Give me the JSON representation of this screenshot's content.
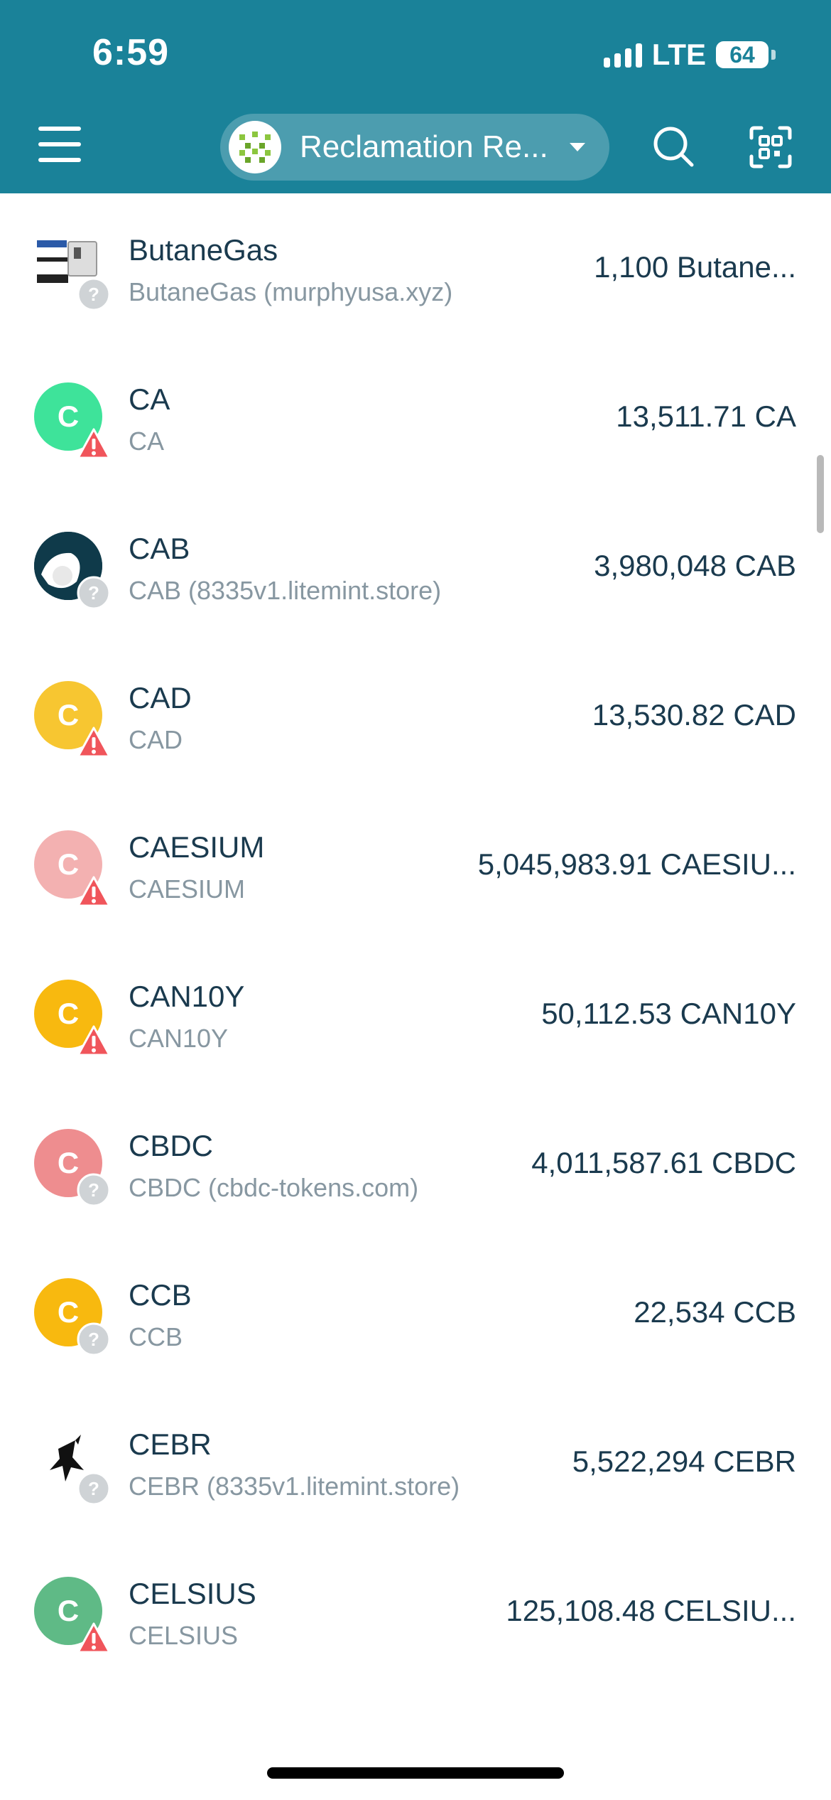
{
  "status": {
    "time": "6:59",
    "network": "LTE",
    "battery": "64",
    "battery_level": 0.64
  },
  "header": {
    "wallet_name": "Reclamation Re...",
    "icons": {
      "menu": "menu-icon",
      "search": "search-icon",
      "scan": "scan-icon",
      "wallet": "wallet-avatar-icon"
    }
  },
  "tokens": [
    {
      "name": "ButaneGas",
      "sub": "ButaneGas (murphyusa.xyz)",
      "balance": "1,100 Butane...",
      "icon_type": "image",
      "icon_color": "#ffffff",
      "badge": "question"
    },
    {
      "name": "CA",
      "sub": "CA",
      "balance": "13,511.71 CA",
      "icon_type": "letter",
      "letter": "C",
      "icon_color": "#3ee39a",
      "badge": "warning"
    },
    {
      "name": "CAB",
      "sub": "CAB (8335v1.litemint.store)",
      "balance": "3,980,048 CAB",
      "icon_type": "image",
      "icon_color": "#0f3a4a",
      "badge": "question"
    },
    {
      "name": "CAD",
      "sub": "CAD",
      "balance": "13,530.82 CAD",
      "icon_type": "letter",
      "letter": "C",
      "icon_color": "#f7c631",
      "badge": "warning"
    },
    {
      "name": "CAESIUM",
      "sub": "CAESIUM",
      "balance": "5,045,983.91 CAESIU...",
      "icon_type": "letter",
      "letter": "C",
      "icon_color": "#f3b1b1",
      "badge": "warning"
    },
    {
      "name": "CAN10Y",
      "sub": "CAN10Y",
      "balance": "50,112.53 CAN10Y",
      "icon_type": "letter",
      "letter": "C",
      "icon_color": "#f8b90f",
      "badge": "warning"
    },
    {
      "name": "CBDC",
      "sub": "CBDC (cbdc-tokens.com)",
      "balance": "4,011,587.61 CBDC",
      "icon_type": "letter",
      "letter": "C",
      "icon_color": "#ee8d8f",
      "badge": "question"
    },
    {
      "name": "CCB",
      "sub": "CCB",
      "balance": "22,534 CCB",
      "icon_type": "letter",
      "letter": "C",
      "icon_color": "#f8b90f",
      "badge": "question"
    },
    {
      "name": "CEBR",
      "sub": "CEBR (8335v1.litemint.store)",
      "balance": "5,522,294 CEBR",
      "icon_type": "image",
      "icon_color": "#ffffff",
      "badge": "question"
    },
    {
      "name": "CELSIUS",
      "sub": "CELSIUS",
      "balance": "125,108.48 CELSIU...",
      "icon_type": "letter",
      "letter": "C",
      "icon_color": "#5fba86",
      "badge": "warning"
    }
  ]
}
